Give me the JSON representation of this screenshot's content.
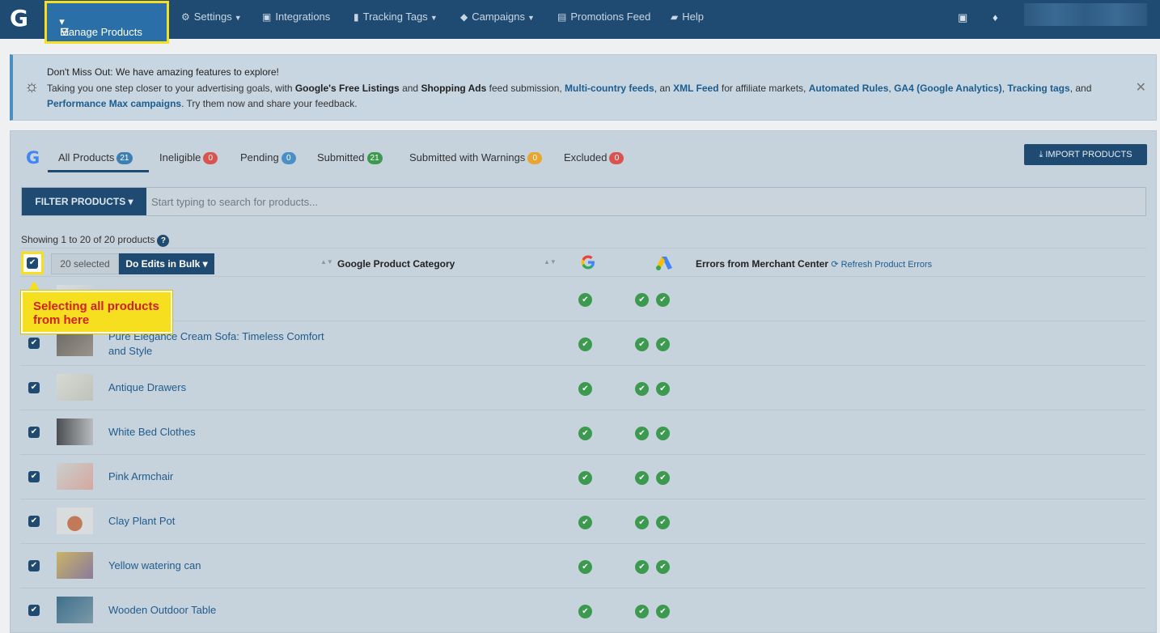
{
  "nav": {
    "logo": "G",
    "active": "Manage Products",
    "items": [
      {
        "label": "Settings",
        "icon": "gear-icon",
        "glyph": "⚙",
        "caret": true
      },
      {
        "label": "Integrations",
        "icon": "briefcase-icon",
        "glyph": "▣",
        "caret": false
      },
      {
        "label": "Tracking Tags",
        "icon": "bar-chart-icon",
        "glyph": "▮",
        "caret": true
      },
      {
        "label": "Campaigns",
        "icon": "tag-icon",
        "glyph": "◆",
        "caret": true
      },
      {
        "label": "Promotions Feed",
        "icon": "document-icon",
        "glyph": "▤",
        "caret": false
      },
      {
        "label": "Help",
        "icon": "chat-icon",
        "glyph": "▰",
        "caret": false
      }
    ]
  },
  "banner": {
    "title": "Don't Miss Out: We have amazing features to explore!",
    "t1": "Taking you one step closer to your advertising goals, with ",
    "b1": "Google's Free Listings",
    "t2": " and ",
    "b2": "Shopping Ads",
    "t3": " feed submission, ",
    "l1": "Multi-country feeds",
    "t4": ", an ",
    "l2": "XML Feed",
    "t5": " for affiliate markets, ",
    "l3": "Automated Rules",
    "t6": ", ",
    "l4": "GA4 (Google Analytics)",
    "t7": ", ",
    "l5": "Tracking tags",
    "t8": ", and ",
    "l6": "Performance Max campaigns",
    "t9": ". Try them now and share your feedback.",
    "close": "✕"
  },
  "tabs": [
    {
      "label": "All Products",
      "count": "21",
      "color": "#3b7fb5"
    },
    {
      "label": "Ineligible",
      "count": "0",
      "color": "#d9534f"
    },
    {
      "label": "Pending",
      "count": "0",
      "color": "#4a90c8"
    },
    {
      "label": "Submitted",
      "count": "21",
      "color": "#3c9a4e"
    },
    {
      "label": "Submitted with Warnings",
      "count": "0",
      "color": "#e8a530"
    },
    {
      "label": "Excluded",
      "count": "0",
      "color": "#d9534f"
    }
  ],
  "import_label": "IMPORT PRODUCTS",
  "filter": {
    "button": "FILTER PRODUCTS ▾",
    "placeholder": "Start typing to search for products..."
  },
  "showing": "Showing 1 to 20 of 20 products",
  "table": {
    "selected": "20 selected",
    "bulk": "Do Edits in Bulk ▾",
    "col_category": "Google Product Category",
    "col_errors": "Errors from Merchant Center",
    "refresh": "Refresh Product Errors"
  },
  "products": [
    {
      "name": "",
      "thumb": [
        "#d8dde0",
        "#c5ccd1"
      ]
    },
    {
      "name": "Pure Elegance Cream Sofa: Timeless Comfort and Style",
      "thumb": [
        "#6b6a66",
        "#9a948a"
      ]
    },
    {
      "name": "Antique Drawers",
      "thumb": [
        "#d7d9d4",
        "#bfc3bb"
      ]
    },
    {
      "name": "White Bed Clothes",
      "thumb": [
        "#4b4e52",
        "#b8bcbe"
      ]
    },
    {
      "name": "Pink Armchair",
      "thumb": [
        "#c9cfcc",
        "#d6a7a0"
      ]
    },
    {
      "name": "Clay Plant Pot",
      "thumb": [
        "#d9dcdc",
        "#c07a58"
      ]
    },
    {
      "name": "Yellow watering can",
      "thumb": [
        "#c8b466",
        "#8a7a9a"
      ]
    },
    {
      "name": "Wooden Outdoor Table",
      "thumb": [
        "#3f6f8c",
        "#7a9aa8"
      ]
    }
  ],
  "callout": "Selecting all products from here"
}
